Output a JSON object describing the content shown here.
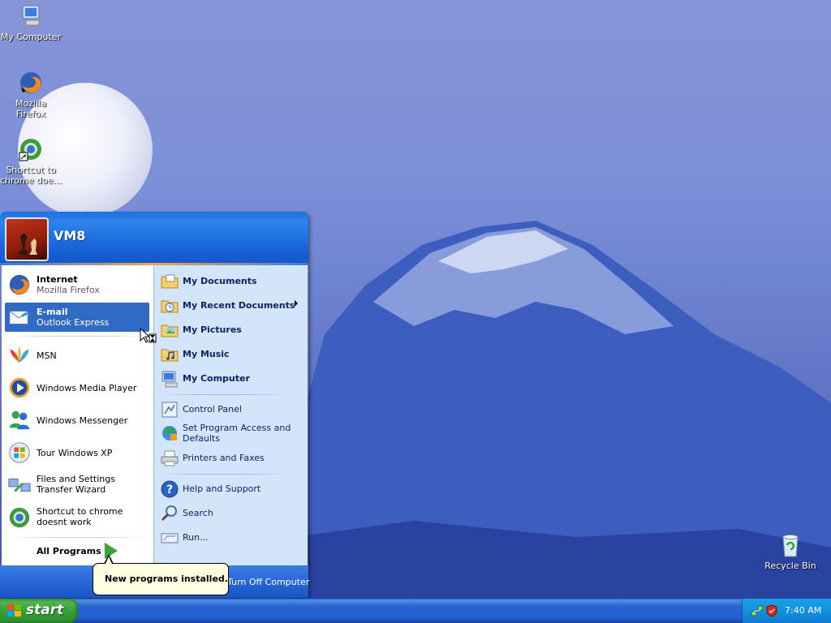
{
  "desktop": {
    "icons": [
      {
        "label": "My Computer",
        "icon": "my-computer-icon"
      },
      {
        "label": "Mozilla Firefox",
        "icon": "firefox-icon"
      },
      {
        "label": "Shortcut to chrome doe...",
        "icon": "chrome-shortcut-icon"
      },
      {
        "label": "Recycle Bin",
        "icon": "recycle-bin-icon"
      }
    ]
  },
  "start_menu": {
    "user_name": "VM8",
    "pinned": [
      {
        "title": "Internet",
        "subtitle": "Mozilla Firefox",
        "icon": "firefox-icon"
      },
      {
        "title": "E-mail",
        "subtitle": "Outlook Express",
        "icon": "outlook-express-icon",
        "selected": true
      }
    ],
    "recent": [
      {
        "label": "MSN",
        "icon": "msn-icon"
      },
      {
        "label": "Windows Media Player",
        "icon": "media-player-icon"
      },
      {
        "label": "Windows Messenger",
        "icon": "messenger-icon"
      },
      {
        "label": "Tour Windows XP",
        "icon": "tour-icon"
      },
      {
        "label": "Files and Settings Transfer Wizard",
        "icon": "transfer-wizard-icon"
      },
      {
        "label": "Shortcut to chrome doesnt work",
        "icon": "chrome-icon"
      }
    ],
    "all_programs": "All Programs",
    "places": [
      {
        "label": "My Documents",
        "icon": "folder-icon"
      },
      {
        "label": "My Recent Documents",
        "icon": "recent-docs-icon"
      },
      {
        "label": "My Pictures",
        "icon": "pictures-folder-icon"
      },
      {
        "label": "My Music",
        "icon": "music-folder-icon"
      },
      {
        "label": "My Computer",
        "icon": "my-computer-icon"
      }
    ],
    "system": [
      {
        "label": "Control Panel",
        "icon": "control-panel-icon"
      },
      {
        "label": "Set Program Access and Defaults",
        "icon": "program-access-icon"
      },
      {
        "label": "Printers and Faxes",
        "icon": "printer-icon"
      }
    ],
    "help": [
      {
        "label": "Help and Support",
        "icon": "help-icon"
      },
      {
        "label": "Search",
        "icon": "search-icon"
      },
      {
        "label": "Run...",
        "icon": "run-icon"
      }
    ],
    "tooltip": "New programs installed.",
    "turn_off": "Turn Off Computer"
  },
  "taskbar": {
    "start_label": "start",
    "clock": "7:40 AM"
  }
}
